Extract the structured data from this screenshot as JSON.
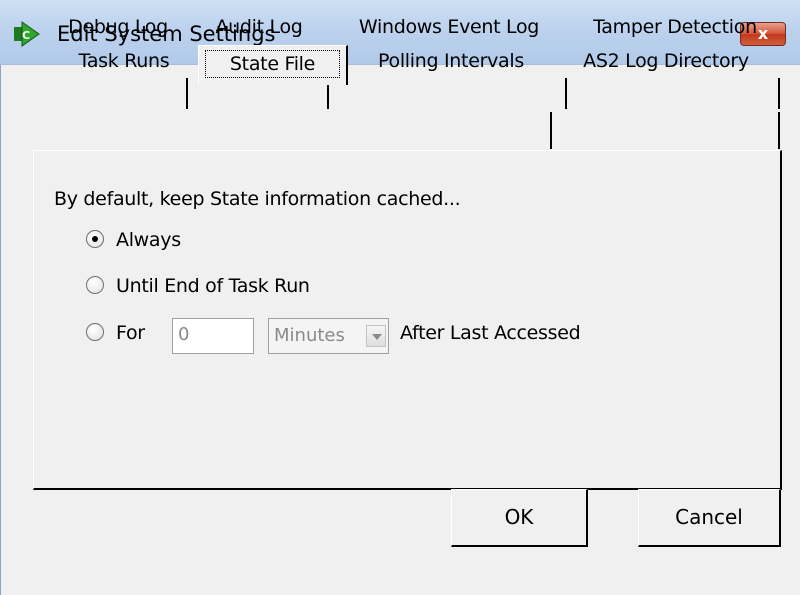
{
  "window": {
    "title": "Edit System Settings",
    "close_label": "x"
  },
  "tabs": {
    "back_row": [
      "Debug Log",
      "Audit Log",
      "Windows Event Log",
      "Tamper Detection"
    ],
    "front_row": [
      "Task Runs",
      "State File",
      "Polling Intervals",
      "AS2 Log Directory"
    ],
    "active": "State File"
  },
  "panel": {
    "intro": "By default, keep State information cached...",
    "options": [
      {
        "label": "Always",
        "selected": true
      },
      {
        "label": "Until End of Task Run",
        "selected": false
      },
      {
        "label": "For",
        "selected": false
      }
    ],
    "for_value": "0",
    "unit_value": "Minutes",
    "after_label": "After Last Accessed"
  },
  "buttons": {
    "ok": "OK",
    "cancel": "Cancel"
  },
  "colors": {
    "titlebar": "#bcd2ee",
    "close": "#c2381c",
    "client": "#f0f0f0"
  },
  "icons": {
    "app": "green-play-arrow-icon",
    "close": "close-icon",
    "dropdown": "chevron-down-icon"
  }
}
